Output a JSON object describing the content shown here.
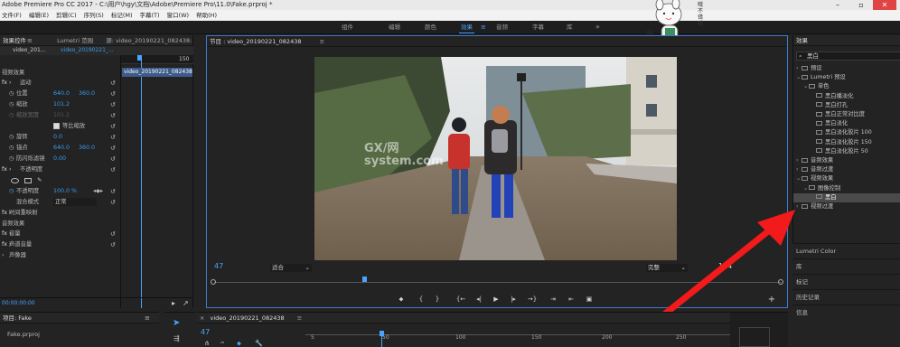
{
  "app": {
    "title": "Adobe Premiere Pro CC 2017 - C:\\用户\\hgy\\文档\\Adobe\\Premiere Pro\\11.0\\Fake.prproj *",
    "menu": [
      "文件(F)",
      "编辑(E)",
      "剪辑(C)",
      "序列(S)",
      "标记(M)",
      "字幕(T)",
      "窗口(W)",
      "帮助(H)"
    ],
    "workspaces": [
      "组件",
      "编辑",
      "颜色",
      "效果",
      "音频",
      "字幕",
      "库"
    ],
    "active_workspace": "效果",
    "close_label": "✕"
  },
  "effect_controls": {
    "tabs": [
      "效果控件",
      "Lumetri 范围",
      "源: video_20190221_082438: vide"
    ],
    "menu_label": "≡",
    "clip_label": "video_201...",
    "clip_label2": "video_20190221_...",
    "section_video": "视频效果",
    "motion": "运动",
    "position_label": "位置",
    "position_x": "640.0",
    "position_y": "360.0",
    "scale_label": "缩放",
    "scale_value": "101.2",
    "scale_width_label": "缩放宽度",
    "scale_width_value": "101.2",
    "uniform_scale": "等比缩放",
    "rotation_label": "旋转",
    "rotation_value": "0.0",
    "anchor_label": "锚点",
    "anchor_x": "640.0",
    "anchor_y": "360.0",
    "antiflicker_label": "防闪烁滤镜",
    "antiflicker_value": "0.00",
    "opacity_section": "不透明度",
    "opacity_label": "不透明度",
    "opacity_value": "100.0 %",
    "blend_label": "混合模式",
    "blend_value": "正常",
    "time_remap": "时间重映射",
    "section_audio": "音频效果",
    "volume": "音量",
    "channel_volume": "声道音量",
    "panner": "声像器",
    "ruler_150": "150",
    "timeline_clip": "video_20190221_082438.m",
    "time_display": "00:00:00:00"
  },
  "program": {
    "header": "节目 : video_20190221_082438",
    "menu_label": "≡",
    "timecode": "47",
    "fit": "适合",
    "quality": "完整",
    "duration": "174",
    "add_btn": "+"
  },
  "effects": {
    "title": "效果",
    "menu_label": "≡",
    "search_value": "黑白",
    "tree": [
      {
        "label": "预设",
        "level": 0,
        "caret": "›"
      },
      {
        "label": "Lumetri 预设",
        "level": 0,
        "caret": "⌄"
      },
      {
        "label": "单色",
        "level": 1,
        "caret": "⌄"
      },
      {
        "label": "黑白播淡化",
        "level": 2,
        "caret": ""
      },
      {
        "label": "黑白打孔",
        "level": 2,
        "caret": ""
      },
      {
        "label": "黑白正常对比度",
        "level": 2,
        "caret": ""
      },
      {
        "label": "黑白淡化",
        "level": 2,
        "caret": ""
      },
      {
        "label": "黑白淡化胶片 100",
        "level": 2,
        "caret": ""
      },
      {
        "label": "黑白淡化胶片 150",
        "level": 2,
        "caret": ""
      },
      {
        "label": "黑白淡化胶片 50",
        "level": 2,
        "caret": ""
      },
      {
        "label": "音频效果",
        "level": 0,
        "caret": "›"
      },
      {
        "label": "音频过渡",
        "level": 0,
        "caret": "›"
      },
      {
        "label": "视频效果",
        "level": 0,
        "caret": "⌄"
      },
      {
        "label": "图像控制",
        "level": 1,
        "caret": "⌄"
      },
      {
        "label": "黑白",
        "level": 2,
        "caret": "",
        "selected": true
      },
      {
        "label": "视频过渡",
        "level": 0,
        "caret": "›"
      }
    ],
    "lower_tabs": [
      "Lumetri Color",
      "库",
      "标记",
      "历史记录",
      "信息"
    ]
  },
  "project": {
    "title": "项目: Fake",
    "menu_label": "≡",
    "file": "Fake.prproj"
  },
  "timeline": {
    "title": "video_20190221_082438",
    "menu_label": "≡",
    "close": "×",
    "timecode": "47",
    "ticks": [
      "5",
      "50",
      "100",
      "150",
      "200",
      "250"
    ]
  },
  "watermark": "GX/网\nsystem.com",
  "sticker_text": "哦不错哦"
}
